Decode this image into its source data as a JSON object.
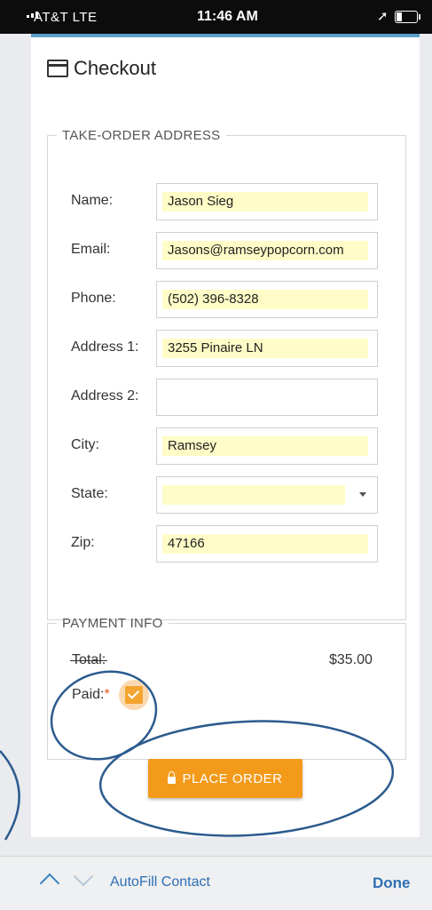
{
  "status_bar": {
    "carrier": "AT&T  LTE",
    "time": "11:46 AM",
    "location_glyph": "➚"
  },
  "checkout": {
    "title": "Checkout",
    "address_section": {
      "legend": "TAKE-ORDER ADDRESS",
      "fields": [
        {
          "label": "Name:",
          "value": "Jason Sieg",
          "autofilled": true
        },
        {
          "label": "Email:",
          "value": "Jasons@ramseypopcorn.com",
          "autofilled": true
        },
        {
          "label": "Phone:",
          "value": "(502) 396-8328",
          "autofilled": true
        },
        {
          "label": "Address 1:",
          "value": "3255 Pinaire LN",
          "autofilled": true
        },
        {
          "label": "Address 2:",
          "value": "",
          "autofilled": false
        },
        {
          "label": "City:",
          "value": "Ramsey",
          "autofilled": true
        },
        {
          "label": "State:",
          "value": "",
          "autofilled": true
        },
        {
          "label": "Zip:",
          "value": "47166",
          "autofilled": true
        }
      ]
    },
    "payment_section": {
      "legend": "PAYMENT INFO",
      "total_label": "Total:",
      "total_value": "$35.00",
      "paid_label": "Paid:",
      "paid_required_mark": "*",
      "paid_checked": true
    },
    "place_order_label": "PLACE ORDER"
  },
  "accessory_bar": {
    "autofill_label": "AutoFill Contact",
    "done_label": "Done"
  },
  "colors": {
    "accent_orange": "#f39a1a",
    "autofill_yellow": "#fffcc7",
    "ios_blue": "#2f6fb1",
    "annotation_blue": "#2b5b8e"
  }
}
